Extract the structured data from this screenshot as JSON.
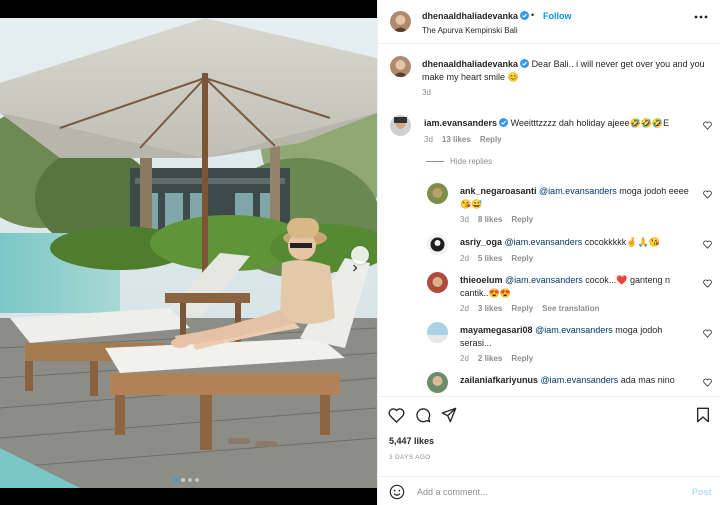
{
  "post": {
    "author": "dhenaaldhaliadevanka",
    "follow_separator": "•",
    "follow_label": "Follow",
    "location": "The Apurva Kempinski Bali",
    "caption_text": "Dear Bali.. i will never get over you and you make my heart smile 😊",
    "caption_age": "3d",
    "likes": "5,447 likes",
    "date": "3 DAYS AGO"
  },
  "photo": {
    "alt": "Woman in a sun hat and off-shoulder top lounging on a wooden sun lounger under a large umbrella beside a pool",
    "carousel_total": 4,
    "carousel_active_index": 0
  },
  "comments": [
    {
      "username": "iam.evansanders",
      "verified": true,
      "text": "Weeitttzzzz dah holiday ajeee🤣🤣🤣E",
      "age": "3d",
      "likes": "13 likes",
      "reply": "Reply"
    }
  ],
  "hide_replies": "Hide replies",
  "replies": [
    {
      "username": "ank_negaroasanti",
      "mention": "@iam.evansanders",
      "text": " moga jodoh eeee😘😅",
      "age": "3d",
      "likes": "8 likes",
      "reply": "Reply",
      "extra": ""
    },
    {
      "username": "asriy_oga",
      "mention": "@iam.evansanders",
      "text": " cocokkkkk🤞🙏😘",
      "age": "2d",
      "likes": "5 likes",
      "reply": "Reply",
      "extra": ""
    },
    {
      "username": "thieoelum",
      "mention": "@iam.evansanders",
      "text": " cocok...❤️ ganteng n cantik..😍😍",
      "age": "2d",
      "likes": "3 likes",
      "reply": "Reply",
      "extra": "See translation"
    },
    {
      "username": "mayamegasari08",
      "mention": "@iam.evansanders",
      "text": " moga jodoh serasi...",
      "age": "2d",
      "likes": "2 likes",
      "reply": "Reply",
      "extra": ""
    },
    {
      "username": "zailaniafkariyunus",
      "mention": "@iam.evansanders",
      "text": " ada mas nino",
      "age": "",
      "likes": "",
      "reply": "",
      "extra": ""
    }
  ],
  "add_comment": {
    "placeholder": "Add a comment...",
    "post_label": "Post"
  },
  "icons": {
    "more": "more-horizontal-icon",
    "like": "heart-icon",
    "comment": "comment-bubble-icon",
    "share": "paper-plane-icon",
    "save": "bookmark-icon",
    "emoji": "smiley-icon",
    "next": "chevron-right-icon",
    "verified": "verified-badge-icon"
  },
  "colors": {
    "accent": "#0095f6",
    "verified": "#3897f0",
    "muted": "#8e8e8e",
    "text": "#262626",
    "post_disabled": "#b2dffc"
  }
}
